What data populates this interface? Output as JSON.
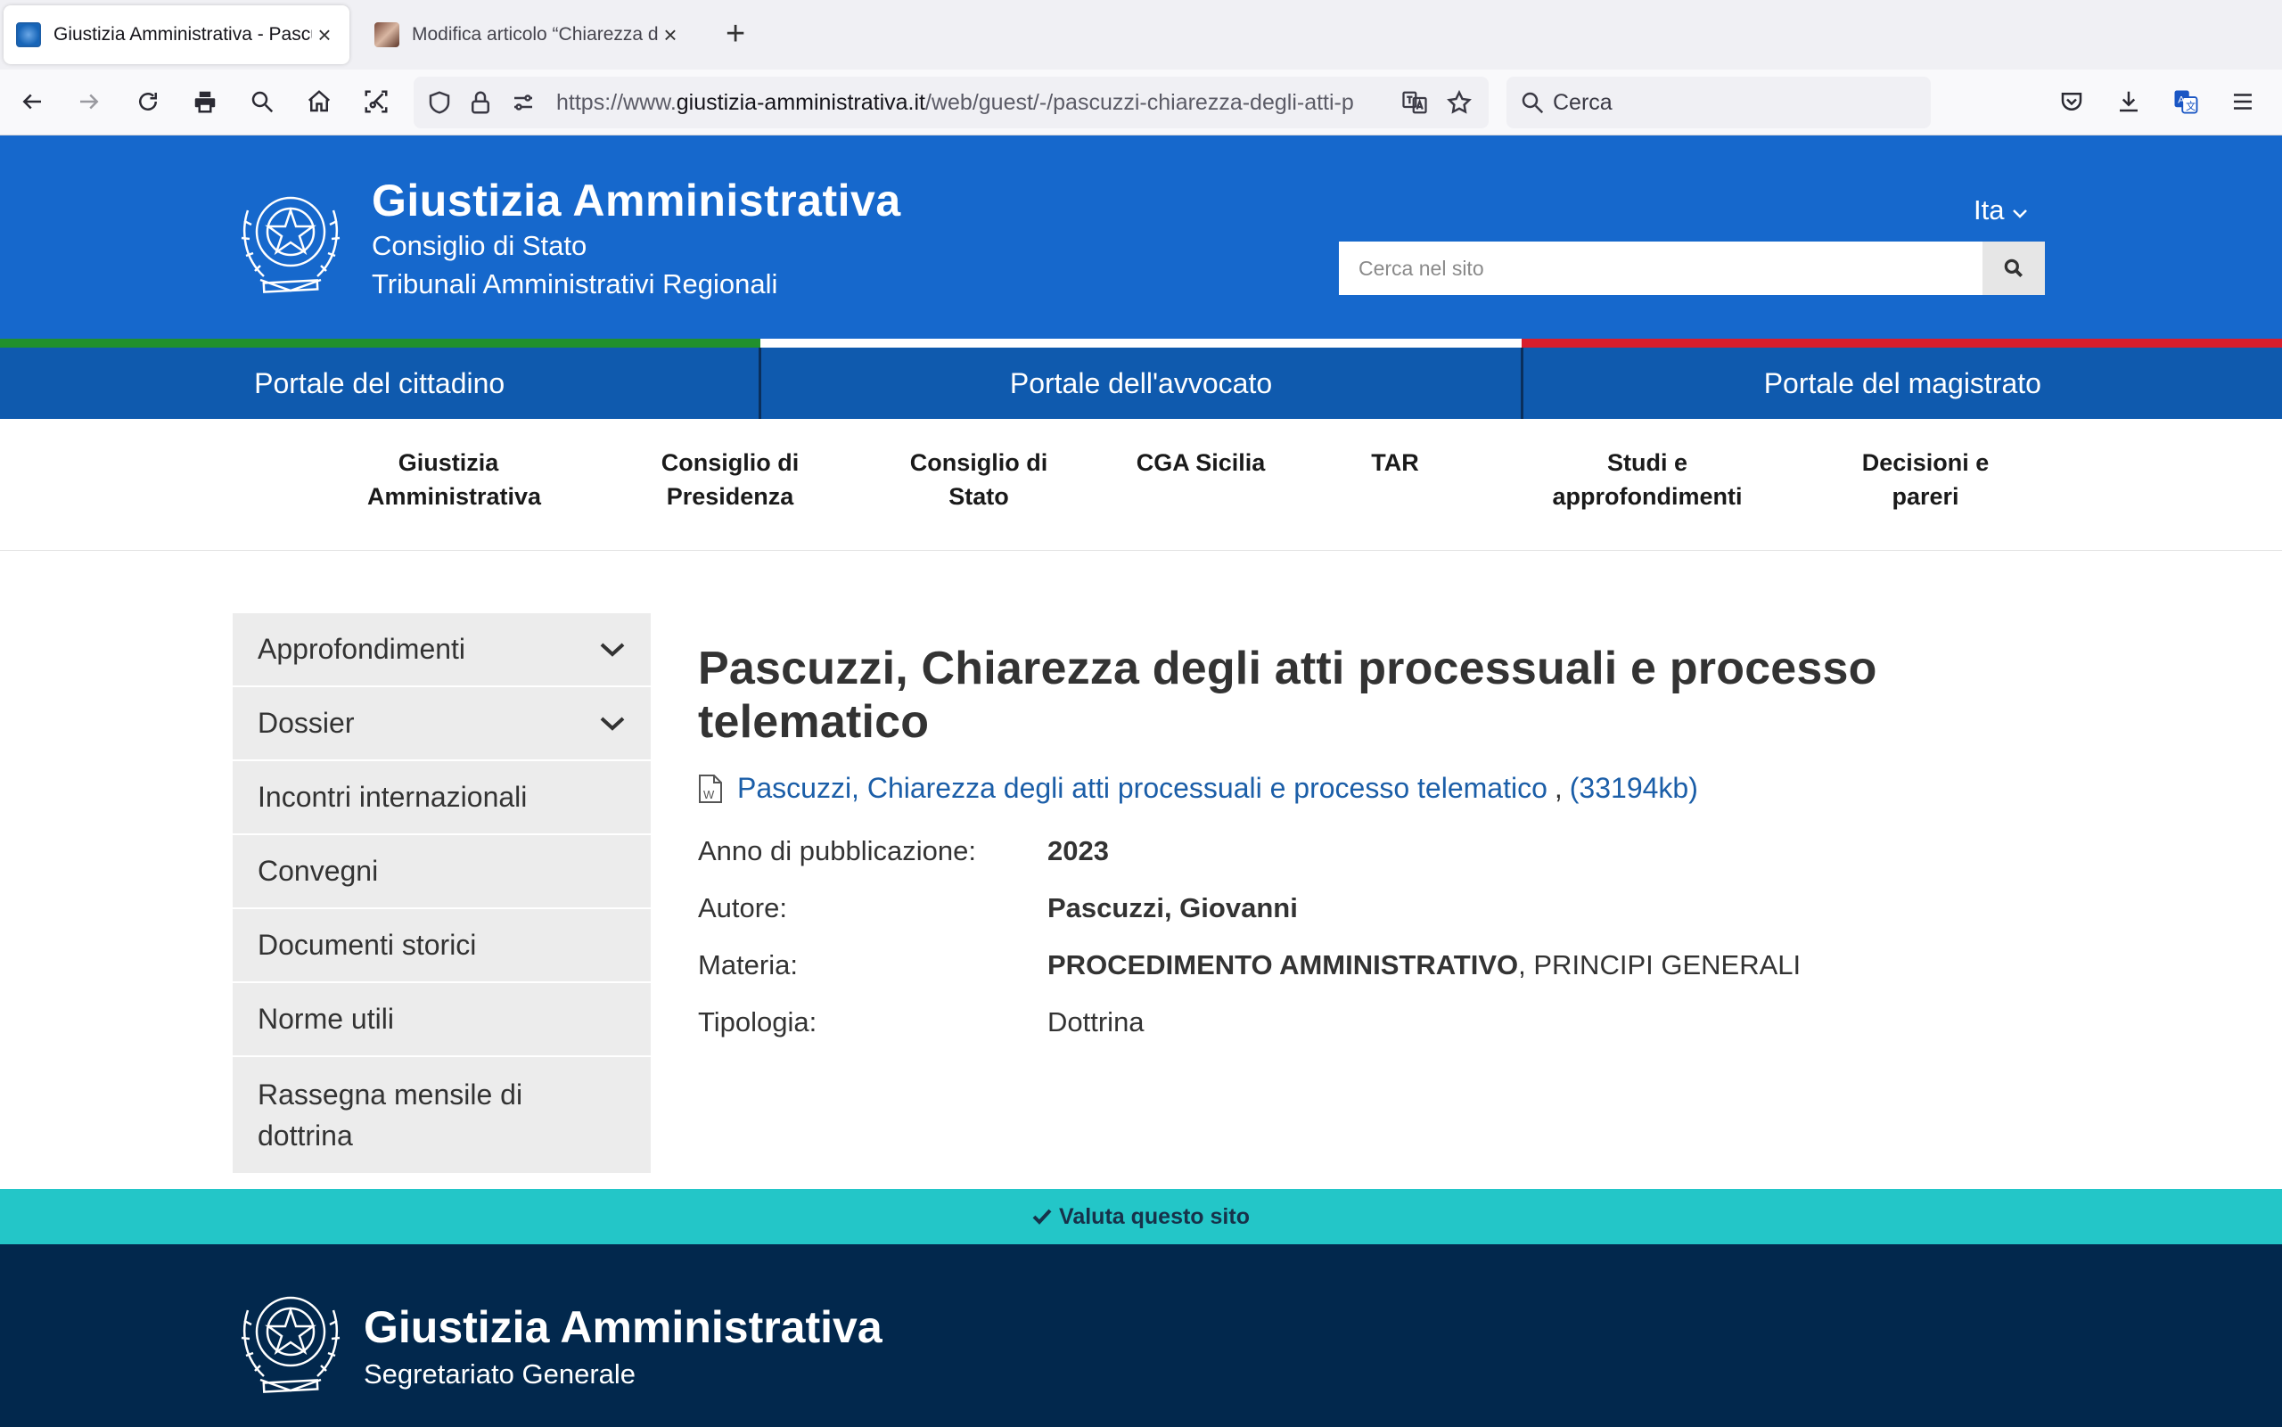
{
  "browser": {
    "tabs": [
      {
        "title": "Giustizia Amministrativa - Pascuzzi",
        "close": "×"
      },
      {
        "title": "Modifica articolo “Chiarezza degli",
        "close": "×"
      }
    ],
    "new_tab": "+",
    "url_prefix": "https://www.",
    "url_domain": "giustizia-amministrativa.it",
    "url_path": "/web/guest/-/pascuzzi-chiarezza-degli-atti-p",
    "search_placeholder": "Cerca"
  },
  "header": {
    "title": "Giustizia Amministrativa",
    "subtitle1": "Consiglio di Stato",
    "subtitle2": "Tribunali Amministrativi Regionali",
    "language": "Ita",
    "search_placeholder": "Cerca nel sito"
  },
  "colors": {
    "header_blue": "#1668cc",
    "portal_blue": "#0f5aae",
    "flag_green": "#21902d",
    "flag_white": "#ffffff",
    "flag_red": "#d81e2c",
    "rate_bar": "#23c6c8",
    "footer": "#02284d",
    "link": "#1b5ea8"
  },
  "portals": [
    "Portale del cittadino",
    "Portale dell'avvocato",
    "Portale del magistrato"
  ],
  "secondary_nav": [
    "Giustizia\nAmministrativa",
    "Consiglio di\nPresidenza",
    "Consiglio di\nStato",
    "CGA Sicilia",
    "TAR",
    "Studi e approfondimenti",
    "Decisioni e\npareri"
  ],
  "sidebar": [
    {
      "label": "Approfondimenti",
      "expandable": true
    },
    {
      "label": "Dossier",
      "expandable": true
    },
    {
      "label": "Incontri internazionali"
    },
    {
      "label": "Convegni"
    },
    {
      "label": "Documenti storici"
    },
    {
      "label": "Norme utili"
    },
    {
      "label": "Rassegna mensile di dottrina"
    }
  ],
  "article": {
    "title": "Pascuzzi, Chiarezza degli atti processuali e processo telematico",
    "doc_link": "Pascuzzi, Chiarezza degli atti processuali e processo telematico",
    "doc_sep": ",",
    "doc_size": "(33194kb)",
    "meta": [
      {
        "key": "Anno di pubblicazione:",
        "value_bold": "2023",
        "value_rest": ""
      },
      {
        "key": "Autore:",
        "value_bold": "Pascuzzi, Giovanni",
        "value_rest": ""
      },
      {
        "key": "Materia:",
        "value_bold": "PROCEDIMENTO AMMINISTRATIVO",
        "value_rest": ", PRINCIPI GENERALI"
      },
      {
        "key": "Tipologia:",
        "value_bold": "",
        "value_rest": "Dottrina"
      }
    ]
  },
  "rate_site": "Valuta questo sito",
  "footer": {
    "title": "Giustizia Amministrativa",
    "subtitle": "Segretariato Generale"
  }
}
